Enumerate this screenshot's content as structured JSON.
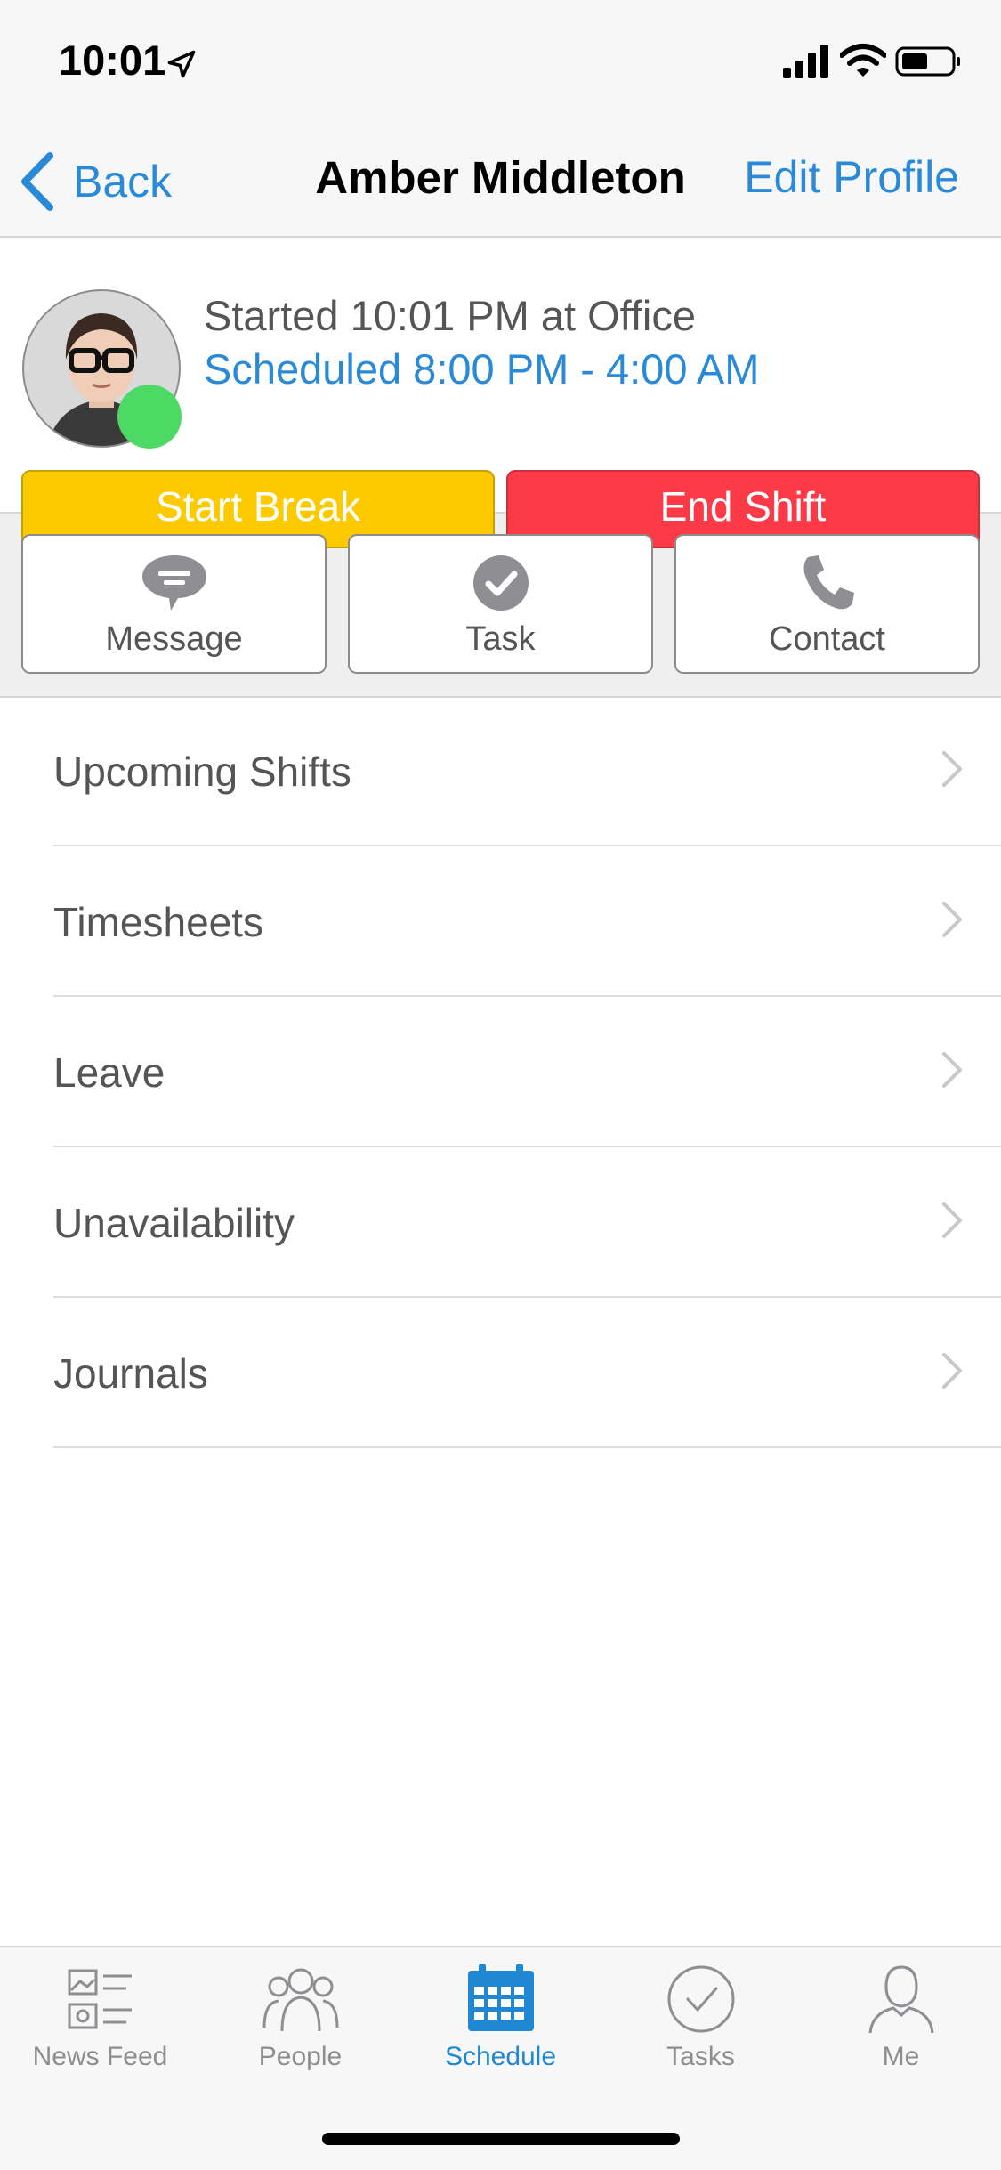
{
  "status_bar": {
    "time": "10:01"
  },
  "nav": {
    "back_label": "Back",
    "title": "Amber Middleton",
    "edit_label": "Edit Profile"
  },
  "profile": {
    "started": "Started 10:01 PM at Office",
    "scheduled": "Scheduled 8:00 PM - 4:00 AM",
    "status_color": "#4cd964"
  },
  "shift_actions": {
    "start_break": "Start Break",
    "end_shift": "End Shift"
  },
  "actions": [
    {
      "label": "Message",
      "icon": "message-icon"
    },
    {
      "label": "Task",
      "icon": "check-circle-icon"
    },
    {
      "label": "Contact",
      "icon": "phone-icon"
    }
  ],
  "menu": [
    {
      "label": "Upcoming Shifts"
    },
    {
      "label": "Timesheets"
    },
    {
      "label": "Leave"
    },
    {
      "label": "Unavailability"
    },
    {
      "label": "Journals"
    }
  ],
  "tabs": [
    {
      "label": "News Feed",
      "icon": "news-feed-icon"
    },
    {
      "label": "People",
      "icon": "people-icon"
    },
    {
      "label": "Schedule",
      "icon": "calendar-icon",
      "active": true
    },
    {
      "label": "Tasks",
      "icon": "tasks-icon"
    },
    {
      "label": "Me",
      "icon": "person-icon"
    }
  ],
  "colors": {
    "accent": "#2b8ad8",
    "start_break": "#fdca00",
    "end_shift": "#fc3a47"
  }
}
